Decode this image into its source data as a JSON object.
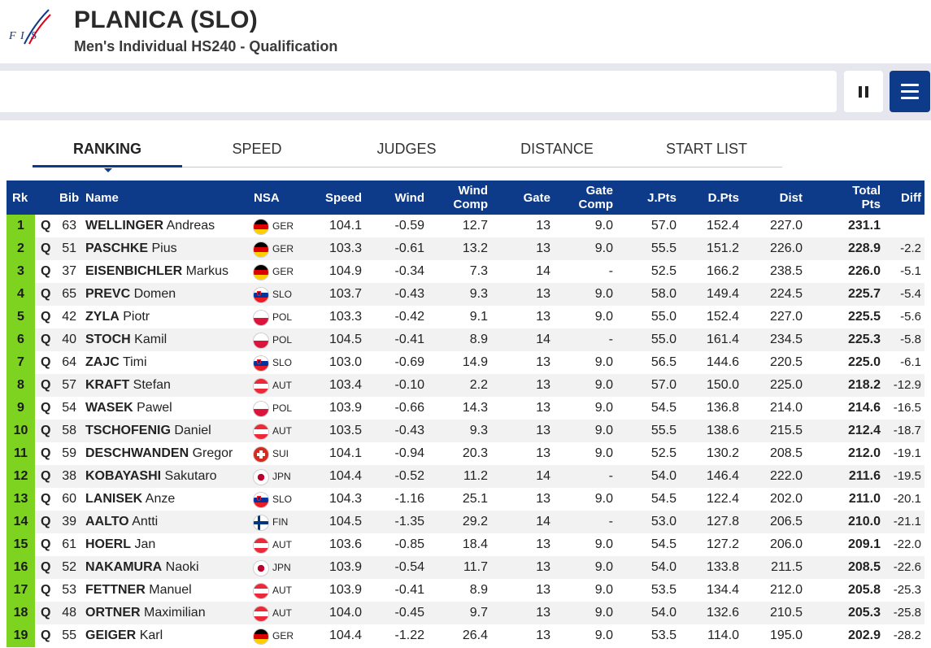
{
  "header": {
    "logo_text": "FIS",
    "title": "PLANICA (SLO)",
    "subtitle": "Men's Individual HS240 - Qualification"
  },
  "controls": {
    "pause_icon": "pause-icon",
    "menu_icon": "hamburger-menu-icon",
    "accent": "#0e3a8a"
  },
  "tabs": [
    {
      "label": "RANKING",
      "active": true
    },
    {
      "label": "SPEED",
      "active": false
    },
    {
      "label": "JUDGES",
      "active": false
    },
    {
      "label": "DISTANCE",
      "active": false
    },
    {
      "label": "START LIST",
      "active": false
    }
  ],
  "columns": {
    "rk": "Rk",
    "bib": "Bib",
    "name": "Name",
    "nsa": "NSA",
    "speed": "Speed",
    "wind": "Wind",
    "wind_comp_1": "Wind",
    "wind_comp_2": "Comp",
    "gate": "Gate",
    "gate_comp_1": "Gate",
    "gate_comp_2": "Comp",
    "jpts": "J.Pts",
    "dpts": "D.Pts",
    "dist": "Dist",
    "total_1": "Total",
    "total_2": "Pts",
    "diff": "Diff"
  },
  "flags": {
    "GER": [
      "#000000",
      "#dd0000",
      "#ffce00"
    ],
    "SLO": [
      "#ffffff",
      "#0033a0",
      "#ed1c24"
    ],
    "POL": [
      "#ffffff",
      "#dc143c"
    ],
    "AUT": [
      "#ed2939",
      "#ffffff",
      "#ed2939"
    ],
    "SUI": [
      "#d52b1e"
    ],
    "JPN": [
      "#ffffff",
      "#bc002d"
    ],
    "FIN": [
      "#ffffff",
      "#003580"
    ]
  },
  "rows": [
    {
      "rk": "1",
      "q": "Q",
      "bib": "63",
      "surname": "WELLINGER",
      "firstname": "Andreas",
      "nsa": "GER",
      "speed": "104.1",
      "wind": "-0.59",
      "wind_comp": "12.7",
      "gate": "13",
      "gate_comp": "9.0",
      "jpts": "57.0",
      "dpts": "152.4",
      "dist": "227.0",
      "total": "231.1",
      "diff": ""
    },
    {
      "rk": "2",
      "q": "Q",
      "bib": "51",
      "surname": "PASCHKE",
      "firstname": "Pius",
      "nsa": "GER",
      "speed": "103.3",
      "wind": "-0.61",
      "wind_comp": "13.2",
      "gate": "13",
      "gate_comp": "9.0",
      "jpts": "55.5",
      "dpts": "151.2",
      "dist": "226.0",
      "total": "228.9",
      "diff": "-2.2"
    },
    {
      "rk": "3",
      "q": "Q",
      "bib": "37",
      "surname": "EISENBICHLER",
      "firstname": "Markus",
      "nsa": "GER",
      "speed": "104.9",
      "wind": "-0.34",
      "wind_comp": "7.3",
      "gate": "14",
      "gate_comp": "-",
      "jpts": "52.5",
      "dpts": "166.2",
      "dist": "238.5",
      "total": "226.0",
      "diff": "-5.1"
    },
    {
      "rk": "4",
      "q": "Q",
      "bib": "65",
      "surname": "PREVC",
      "firstname": "Domen",
      "nsa": "SLO",
      "speed": "103.7",
      "wind": "-0.43",
      "wind_comp": "9.3",
      "gate": "13",
      "gate_comp": "9.0",
      "jpts": "58.0",
      "dpts": "149.4",
      "dist": "224.5",
      "total": "225.7",
      "diff": "-5.4"
    },
    {
      "rk": "5",
      "q": "Q",
      "bib": "42",
      "surname": "ZYLA",
      "firstname": "Piotr",
      "nsa": "POL",
      "speed": "103.3",
      "wind": "-0.42",
      "wind_comp": "9.1",
      "gate": "13",
      "gate_comp": "9.0",
      "jpts": "55.0",
      "dpts": "152.4",
      "dist": "227.0",
      "total": "225.5",
      "diff": "-5.6"
    },
    {
      "rk": "6",
      "q": "Q",
      "bib": "40",
      "surname": "STOCH",
      "firstname": "Kamil",
      "nsa": "POL",
      "speed": "104.5",
      "wind": "-0.41",
      "wind_comp": "8.9",
      "gate": "14",
      "gate_comp": "-",
      "jpts": "55.0",
      "dpts": "161.4",
      "dist": "234.5",
      "total": "225.3",
      "diff": "-5.8"
    },
    {
      "rk": "7",
      "q": "Q",
      "bib": "64",
      "surname": "ZAJC",
      "firstname": "Timi",
      "nsa": "SLO",
      "speed": "103.0",
      "wind": "-0.69",
      "wind_comp": "14.9",
      "gate": "13",
      "gate_comp": "9.0",
      "jpts": "56.5",
      "dpts": "144.6",
      "dist": "220.5",
      "total": "225.0",
      "diff": "-6.1"
    },
    {
      "rk": "8",
      "q": "Q",
      "bib": "57",
      "surname": "KRAFT",
      "firstname": "Stefan",
      "nsa": "AUT",
      "speed": "103.4",
      "wind": "-0.10",
      "wind_comp": "2.2",
      "gate": "13",
      "gate_comp": "9.0",
      "jpts": "57.0",
      "dpts": "150.0",
      "dist": "225.0",
      "total": "218.2",
      "diff": "-12.9"
    },
    {
      "rk": "9",
      "q": "Q",
      "bib": "54",
      "surname": "WASEK",
      "firstname": "Pawel",
      "nsa": "POL",
      "speed": "103.9",
      "wind": "-0.66",
      "wind_comp": "14.3",
      "gate": "13",
      "gate_comp": "9.0",
      "jpts": "54.5",
      "dpts": "136.8",
      "dist": "214.0",
      "total": "214.6",
      "diff": "-16.5"
    },
    {
      "rk": "10",
      "q": "Q",
      "bib": "58",
      "surname": "TSCHOFENIG",
      "firstname": "Daniel",
      "nsa": "AUT",
      "speed": "103.5",
      "wind": "-0.43",
      "wind_comp": "9.3",
      "gate": "13",
      "gate_comp": "9.0",
      "jpts": "55.5",
      "dpts": "138.6",
      "dist": "215.5",
      "total": "212.4",
      "diff": "-18.7"
    },
    {
      "rk": "11",
      "q": "Q",
      "bib": "59",
      "surname": "DESCHWANDEN",
      "firstname": "Gregor",
      "nsa": "SUI",
      "speed": "104.1",
      "wind": "-0.94",
      "wind_comp": "20.3",
      "gate": "13",
      "gate_comp": "9.0",
      "jpts": "52.5",
      "dpts": "130.2",
      "dist": "208.5",
      "total": "212.0",
      "diff": "-19.1"
    },
    {
      "rk": "12",
      "q": "Q",
      "bib": "38",
      "surname": "KOBAYASHI",
      "firstname": "Sakutaro",
      "nsa": "JPN",
      "speed": "104.4",
      "wind": "-0.52",
      "wind_comp": "11.2",
      "gate": "14",
      "gate_comp": "-",
      "jpts": "54.0",
      "dpts": "146.4",
      "dist": "222.0",
      "total": "211.6",
      "diff": "-19.5"
    },
    {
      "rk": "13",
      "q": "Q",
      "bib": "60",
      "surname": "LANISEK",
      "firstname": "Anze",
      "nsa": "SLO",
      "speed": "104.3",
      "wind": "-1.16",
      "wind_comp": "25.1",
      "gate": "13",
      "gate_comp": "9.0",
      "jpts": "54.5",
      "dpts": "122.4",
      "dist": "202.0",
      "total": "211.0",
      "diff": "-20.1"
    },
    {
      "rk": "14",
      "q": "Q",
      "bib": "39",
      "surname": "AALTO",
      "firstname": "Antti",
      "nsa": "FIN",
      "speed": "104.5",
      "wind": "-1.35",
      "wind_comp": "29.2",
      "gate": "14",
      "gate_comp": "-",
      "jpts": "53.0",
      "dpts": "127.8",
      "dist": "206.5",
      "total": "210.0",
      "diff": "-21.1"
    },
    {
      "rk": "15",
      "q": "Q",
      "bib": "61",
      "surname": "HOERL",
      "firstname": "Jan",
      "nsa": "AUT",
      "speed": "103.6",
      "wind": "-0.85",
      "wind_comp": "18.4",
      "gate": "13",
      "gate_comp": "9.0",
      "jpts": "54.5",
      "dpts": "127.2",
      "dist": "206.0",
      "total": "209.1",
      "diff": "-22.0"
    },
    {
      "rk": "16",
      "q": "Q",
      "bib": "52",
      "surname": "NAKAMURA",
      "firstname": "Naoki",
      "nsa": "JPN",
      "speed": "103.9",
      "wind": "-0.54",
      "wind_comp": "11.7",
      "gate": "13",
      "gate_comp": "9.0",
      "jpts": "54.0",
      "dpts": "133.8",
      "dist": "211.5",
      "total": "208.5",
      "diff": "-22.6"
    },
    {
      "rk": "17",
      "q": "Q",
      "bib": "53",
      "surname": "FETTNER",
      "firstname": "Manuel",
      "nsa": "AUT",
      "speed": "103.9",
      "wind": "-0.41",
      "wind_comp": "8.9",
      "gate": "13",
      "gate_comp": "9.0",
      "jpts": "53.5",
      "dpts": "134.4",
      "dist": "212.0",
      "total": "205.8",
      "diff": "-25.3"
    },
    {
      "rk": "18",
      "q": "Q",
      "bib": "48",
      "surname": "ORTNER",
      "firstname": "Maximilian",
      "nsa": "AUT",
      "speed": "104.0",
      "wind": "-0.45",
      "wind_comp": "9.7",
      "gate": "13",
      "gate_comp": "9.0",
      "jpts": "54.0",
      "dpts": "132.6",
      "dist": "210.5",
      "total": "205.3",
      "diff": "-25.8"
    },
    {
      "rk": "19",
      "q": "Q",
      "bib": "55",
      "surname": "GEIGER",
      "firstname": "Karl",
      "nsa": "GER",
      "speed": "104.4",
      "wind": "-1.22",
      "wind_comp": "26.4",
      "gate": "13",
      "gate_comp": "9.0",
      "jpts": "53.5",
      "dpts": "114.0",
      "dist": "195.0",
      "total": "202.9",
      "diff": "-28.2"
    }
  ]
}
